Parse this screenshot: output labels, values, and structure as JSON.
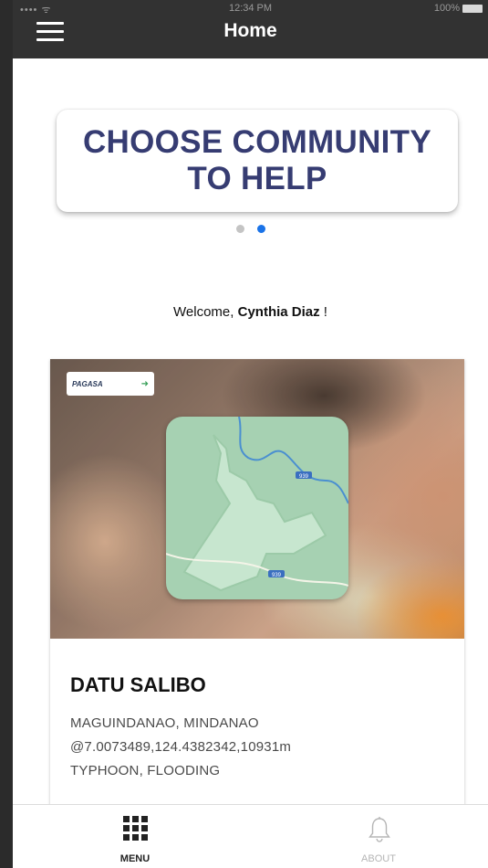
{
  "status_bar": {
    "signal": "••••  ᯤ",
    "time": "12:34 PM",
    "battery": "100%"
  },
  "navbar": {
    "title": "Home",
    "menu_icon": "hamburger-icon"
  },
  "banner": {
    "line1": "CHOOSE COMMUNITY",
    "line2": "TO HELP",
    "page_count": 2,
    "active_page": 2
  },
  "welcome": {
    "prefix": "Welcome, ",
    "name": "Cynthia Diaz",
    "suffix": " !"
  },
  "community_card": {
    "logo_text": "PAGASA",
    "title": "DATU SALIBO",
    "region": "MAGUINDANAO, MINDANAO",
    "coordinates": "@7.0073489,124.4382342,10931m",
    "hazards": "TYPHOON, FLOODING"
  },
  "map_labels": {
    "road1": "939",
    "road2": "939"
  },
  "tabbar": {
    "items": [
      {
        "label": "MENU",
        "icon": "grid-icon",
        "active": true
      },
      {
        "label": "ABOUT",
        "icon": "bell-icon",
        "active": false
      }
    ]
  },
  "colors": {
    "navbar": "#323232",
    "banner_text": "#363c72",
    "active_dot": "#1a73e8",
    "map": "#a6d1b2"
  }
}
